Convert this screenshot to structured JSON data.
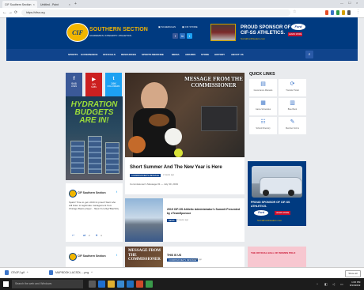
{
  "browser": {
    "tabs": [
      {
        "label": "CIF Southern Section",
        "active": true
      },
      {
        "label": "Untitled - Paint",
        "active": false
      }
    ],
    "url": "https://cifss.org",
    "nav_back": "←",
    "nav_forward": "→",
    "nav_reload": "⟳"
  },
  "header": {
    "logo_text": "CIF",
    "site_title": "SOUTHERN SECTION",
    "site_tagline": "ACADEMICS. INTEGRITY. ATHLETICS.",
    "schedules_link": "SCHEDULES",
    "cif_store_link": "CIF STORE",
    "social": [
      "f",
      "in",
      "t"
    ],
    "ad_line1": "PROUD SPONSOR OF",
    "ad_line2": "CIF-SS ATHLETICS.",
    "ad_url": "SoCalFordDealers.com",
    "ad_brand": "Ford",
    "ad_cta": "LEARN MORE"
  },
  "nav": {
    "items": [
      "SPORTS",
      "GOVERNANCE",
      "OFFICIALS",
      "RESOURCES",
      "SPORTS MEDICINE",
      "MEDIA",
      "AWARDS",
      "STORE",
      "HISTORY",
      "ABOUT US"
    ],
    "search_icon": "⌕"
  },
  "share": [
    {
      "icon": "f",
      "count": "946",
      "label": "LIKES",
      "color": "#3b5998"
    },
    {
      "icon": "▶",
      "count": "20",
      "label": "SUBS",
      "color": "#cc2020"
    },
    {
      "icon": "t",
      "count": "19K",
      "label": "FOLLOWERS",
      "color": "#1da1f2"
    }
  ],
  "promo": {
    "headline": "HYDRATION BUDGETS ARE IN!"
  },
  "tweet": {
    "name": "CIF Southern Section",
    "body": "Spark! Time to get LOUD & proud! Start who will listen to legitimate management from Chicago Bears player... https://t.co/4gYBaeSiUj",
    "reply": "↩",
    "retweet": "⇄",
    "retweet_count": "2",
    "like": "♥",
    "like_count": "4"
  },
  "tweet2": {
    "name": "CIF Southern Section"
  },
  "hero": {
    "overlay_title": "MESSAGE FROM THE COMMISSIONER",
    "headline": "Short Summer And The New Year is Here",
    "badge": "COMMISSIONER'S MESSAGE",
    "time": "2 weeks ago",
    "subline": "Commissioner's Message #1 — July 30, 2019"
  },
  "article2": {
    "headline": "2019 CIF-SS Athletic Administrator's Summit Presented by eTeamSponsor",
    "badge": "NEWS",
    "time": "3 weeks ago"
  },
  "article3": {
    "thumb_text": "MESSAGE FROM THE COMMISSIONER",
    "headline": "THIS IS US",
    "badge": "COMMISSIONER'S MESSAGE",
    "time": "1 month ago"
  },
  "quick_links": {
    "title": "QUICK LINKS",
    "items": [
      {
        "icon": "▤",
        "label": "Governance Manuals"
      },
      {
        "icon": "⟳",
        "label": "Transfer Portal"
      },
      {
        "icon": "▦",
        "label": "Game Schedules"
      },
      {
        "icon": "▥",
        "label": "Blue Book"
      },
      {
        "icon": "☷",
        "label": "School Directory"
      },
      {
        "icon": "✎",
        "label": "Member Forms"
      }
    ]
  },
  "right_ad": {
    "text": "PROUD SPONSOR OF CIF-SS ATHLETICS.",
    "brand": "Ford",
    "cta": "LEARN MORE",
    "url": "SoCalFordDealers.com"
  },
  "right_ad2": {
    "text": "THE OFFICIAL BALL OF WOMEN POLO"
  },
  "downloads": [
    {
      "name": "OTc2FJ.gif"
    },
    {
      "name": "MAPBOOK-LACSDL....png"
    }
  ],
  "downloads_show_all": "Show all",
  "taskbar": {
    "search_placeholder": "Search the web and Windows",
    "time": "1:06 PM",
    "date": "8/13/2019"
  },
  "colors": {
    "brand_blue": "#003a80",
    "nav_blue": "#10448c",
    "brand_gold": "#f2b600",
    "ford_red": "#c8102e"
  }
}
